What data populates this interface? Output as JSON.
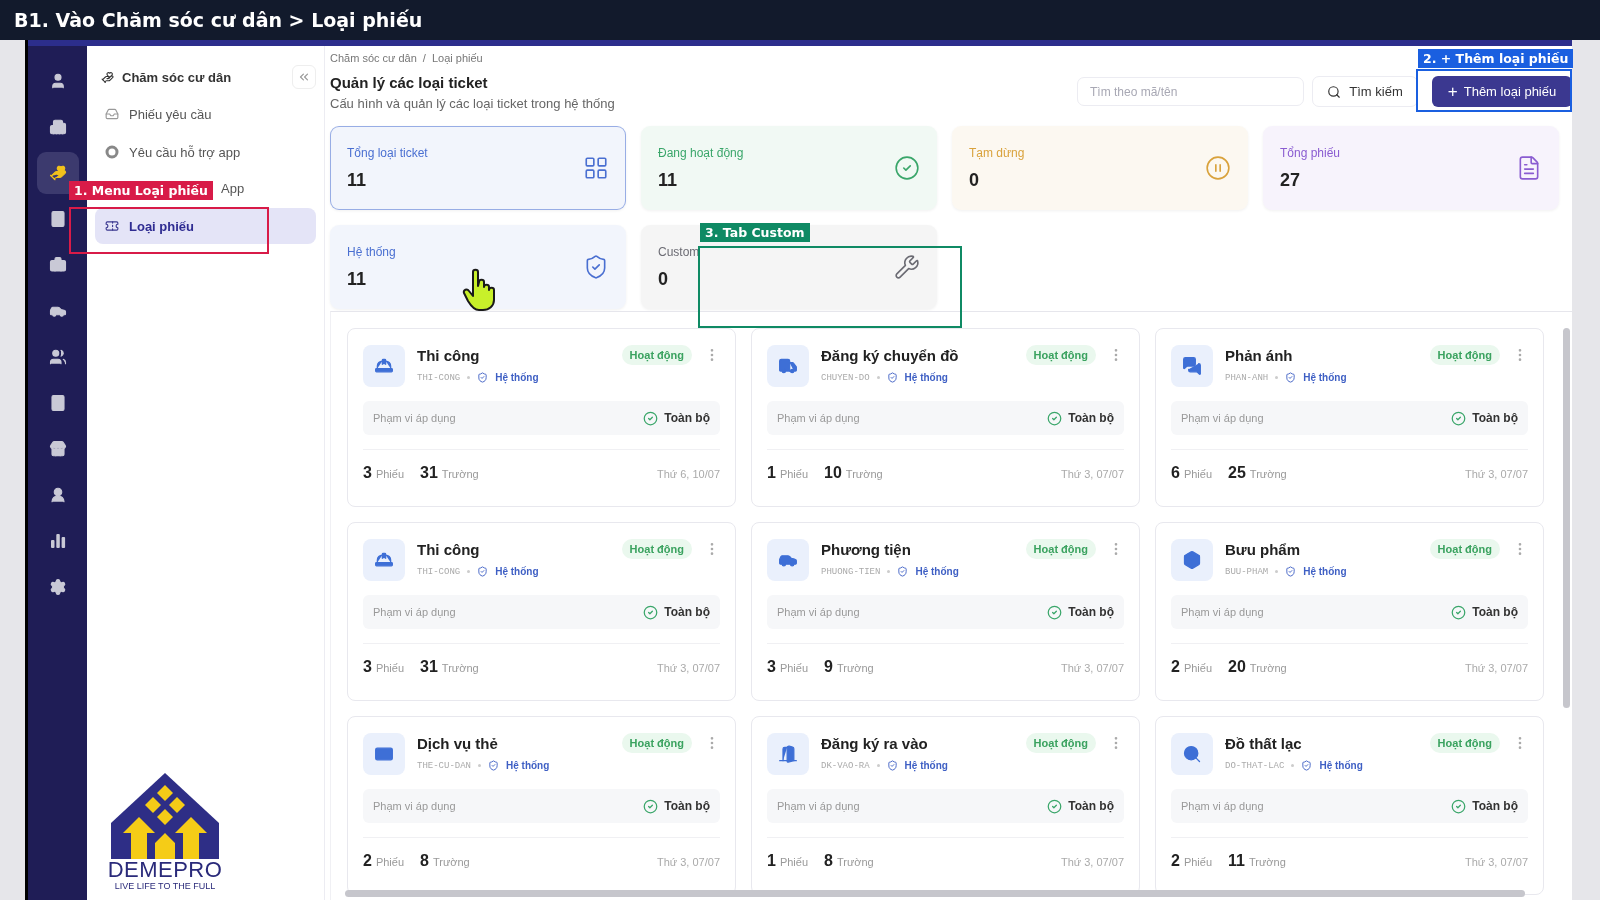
{
  "banner": {
    "title": "B1. Vào Chăm sóc cư dân > Loại phiếu"
  },
  "rail": [
    {
      "selected": false
    },
    {
      "selected": false
    },
    {
      "selected": true
    },
    {
      "selected": false
    },
    {
      "selected": false
    },
    {
      "selected": false
    },
    {
      "selected": false
    },
    {
      "selected": false
    },
    {
      "selected": false
    },
    {
      "selected": false
    },
    {
      "selected": false
    },
    {
      "selected": false
    }
  ],
  "sidebar": {
    "title": "Chăm sóc cư dân",
    "items": [
      {
        "label": "Phiếu yêu cầu",
        "kind": "link",
        "selected": false
      },
      {
        "label": "Yêu cầu hỗ trợ app",
        "kind": "link",
        "selected": false
      },
      {
        "label": "App",
        "kind": "covered",
        "selected": false
      },
      {
        "label": "Loại phiếu",
        "kind": "link",
        "selected": true
      }
    ]
  },
  "logo": {
    "name": "DEMEPRO",
    "tagline": "LIVE LIFE TO THE FULL"
  },
  "breadcrumb": {
    "items": [
      "Chăm sóc cư dân",
      "Loại phiếu"
    ],
    "separator": "/"
  },
  "page": {
    "title": "Quản lý các loại ticket",
    "subtitle": "Cấu hình và quản lý các loại ticket trong hệ thống"
  },
  "search": {
    "placeholder": "Tìm theo mã/tên",
    "button": "Tìm kiếm"
  },
  "add_button": {
    "icon": "+",
    "label": "Thêm loại phiếu"
  },
  "stats": [
    {
      "label": "Tổng loại ticket",
      "value": "11",
      "color": "#4a6fd1",
      "selected": true
    },
    {
      "label": "Đang hoạt động",
      "value": "11",
      "color": "#3aa66a",
      "selected": false
    },
    {
      "label": "Tạm dừng",
      "value": "0",
      "color": "#d9a23c",
      "selected": false
    },
    {
      "label": "Tổng phiếu",
      "value": "27",
      "color": "#8a5cd1",
      "selected": false
    },
    {
      "label": "Hệ thống",
      "value": "11",
      "color": "#4a6fd1",
      "selected": false
    },
    {
      "label": "Custom",
      "value": "0",
      "color": "#6b6b73",
      "selected": false
    }
  ],
  "tickets": [
    {
      "name": "Thi công",
      "code": "THI-CONG",
      "scope_type": "Hệ thống",
      "status": "Hoạt động",
      "scope_label": "Phạm vi áp dụng",
      "scope": "Toàn bộ",
      "tickets": "3",
      "tickets_label": "Phiếu",
      "fields": "31",
      "fields_label": "Trường",
      "date": "Thứ 6, 10/07"
    },
    {
      "name": "Đăng ký chuyển đồ",
      "code": "CHUYEN-DO",
      "scope_type": "Hệ thống",
      "status": "Hoạt động",
      "scope_label": "Phạm vi áp dụng",
      "scope": "Toàn bộ",
      "tickets": "1",
      "tickets_label": "Phiếu",
      "fields": "10",
      "fields_label": "Trường",
      "date": "Thứ 3, 07/07"
    },
    {
      "name": "Phản ánh",
      "code": "PHAN-ANH",
      "scope_type": "Hệ thống",
      "status": "Hoạt động",
      "scope_label": "Phạm vi áp dụng",
      "scope": "Toàn bộ",
      "tickets": "6",
      "tickets_label": "Phiếu",
      "fields": "25",
      "fields_label": "Trường",
      "date": "Thứ 3, 07/07"
    },
    {
      "name": "Thi công",
      "code": "THI-CONG",
      "scope_type": "Hệ thống",
      "status": "Hoạt động",
      "scope_label": "Phạm vi áp dụng",
      "scope": "Toàn bộ",
      "tickets": "3",
      "tickets_label": "Phiếu",
      "fields": "31",
      "fields_label": "Trường",
      "date": "Thứ 3, 07/07"
    },
    {
      "name": "Phương tiện",
      "code": "PHUONG-TIEN",
      "scope_type": "Hệ thống",
      "status": "Hoạt động",
      "scope_label": "Phạm vi áp dụng",
      "scope": "Toàn bộ",
      "tickets": "3",
      "tickets_label": "Phiếu",
      "fields": "9",
      "fields_label": "Trường",
      "date": "Thứ 3, 07/07"
    },
    {
      "name": "Bưu phẩm",
      "code": "BUU-PHAM",
      "scope_type": "Hệ thống",
      "status": "Hoạt động",
      "scope_label": "Phạm vi áp dụng",
      "scope": "Toàn bộ",
      "tickets": "2",
      "tickets_label": "Phiếu",
      "fields": "20",
      "fields_label": "Trường",
      "date": "Thứ 3, 07/07"
    },
    {
      "name": "Dịch vụ thẻ",
      "code": "THE-CU-DAN",
      "scope_type": "Hệ thống",
      "status": "Hoạt động",
      "scope_label": "Phạm vi áp dụng",
      "scope": "Toàn bộ",
      "tickets": "2",
      "tickets_label": "Phiếu",
      "fields": "8",
      "fields_label": "Trường",
      "date": "Thứ 3, 07/07"
    },
    {
      "name": "Đăng ký ra vào",
      "code": "DK-VAO-RA",
      "scope_type": "Hệ thống",
      "status": "Hoạt động",
      "scope_label": "Phạm vi áp dụng",
      "scope": "Toàn bộ",
      "tickets": "1",
      "tickets_label": "Phiếu",
      "fields": "8",
      "fields_label": "Trường",
      "date": "Thứ 3, 07/07"
    },
    {
      "name": "Đồ thất lạc",
      "code": "DO-THAT-LAC",
      "scope_type": "Hệ thống",
      "status": "Hoạt động",
      "scope_label": "Phạm vi áp dụng",
      "scope": "Toàn bộ",
      "tickets": "2",
      "tickets_label": "Phiếu",
      "fields": "11",
      "fields_label": "Trường",
      "date": "Thứ 3, 07/07"
    }
  ],
  "annotations": [
    {
      "label": "1. Menu Loại phiếu",
      "color": "#d81b48"
    },
    {
      "label": "2. + Thêm loại phiếu",
      "color": "#1a5fe0"
    },
    {
      "label": "3. Tab Custom",
      "color": "#0f8a64"
    }
  ]
}
